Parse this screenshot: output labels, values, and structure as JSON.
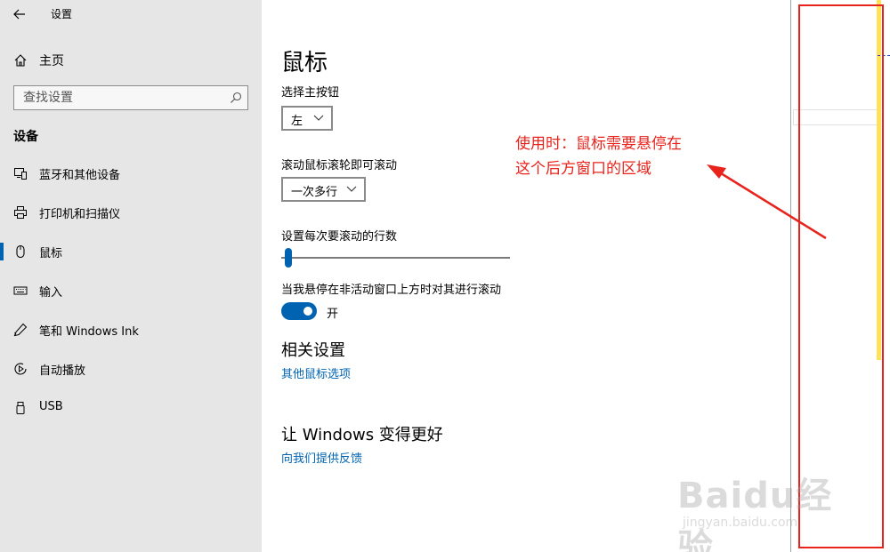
{
  "window": {
    "title": "设置",
    "controls": [
      "minimize",
      "maximize",
      "close"
    ]
  },
  "sidebar": {
    "home_label": "主页",
    "search_placeholder": "查找设置",
    "section_label": "设备",
    "items": [
      {
        "label": "蓝牙和其他设备",
        "icon": "bluetooth-devices-icon"
      },
      {
        "label": "打印机和扫描仪",
        "icon": "printer-icon"
      },
      {
        "label": "鼠标",
        "icon": "mouse-icon",
        "active": true
      },
      {
        "label": "输入",
        "icon": "keyboard-icon"
      },
      {
        "label": "笔和 Windows Ink",
        "icon": "pen-icon"
      },
      {
        "label": "自动播放",
        "icon": "autoplay-icon"
      },
      {
        "label": "USB",
        "icon": "usb-icon"
      }
    ]
  },
  "main": {
    "title": "鼠标",
    "primary_button_label": "选择主按钮",
    "primary_button_value": "左",
    "scroll_label": "滚动鼠标滚轮即可滚动",
    "scroll_value": "一次多行",
    "lines_label": "设置每次要滚动的行数",
    "lines_slider_fraction": 0.03,
    "inactive_scroll_label": "当我悬停在非活动窗口上方时对其进行滚动",
    "inactive_scroll_state": "开",
    "related_title": "相关设置",
    "related_link": "其他鼠标选项",
    "feedback_title": "让 Windows 变得更好",
    "feedback_link": "向我们提供反馈"
  },
  "annotation": {
    "line1": "使用时：鼠标需要悬停在",
    "line2": "这个后方窗口的区域",
    "color": "#e8231c"
  },
  "watermark": {
    "logo": "Baidu经验",
    "url": "jingyan.baidu.com"
  },
  "colors": {
    "accent": "#0063b1",
    "sidebar_bg": "#e6e6e6",
    "annotation_red": "#e8231c",
    "highlight_yellow": "#fde25a"
  }
}
